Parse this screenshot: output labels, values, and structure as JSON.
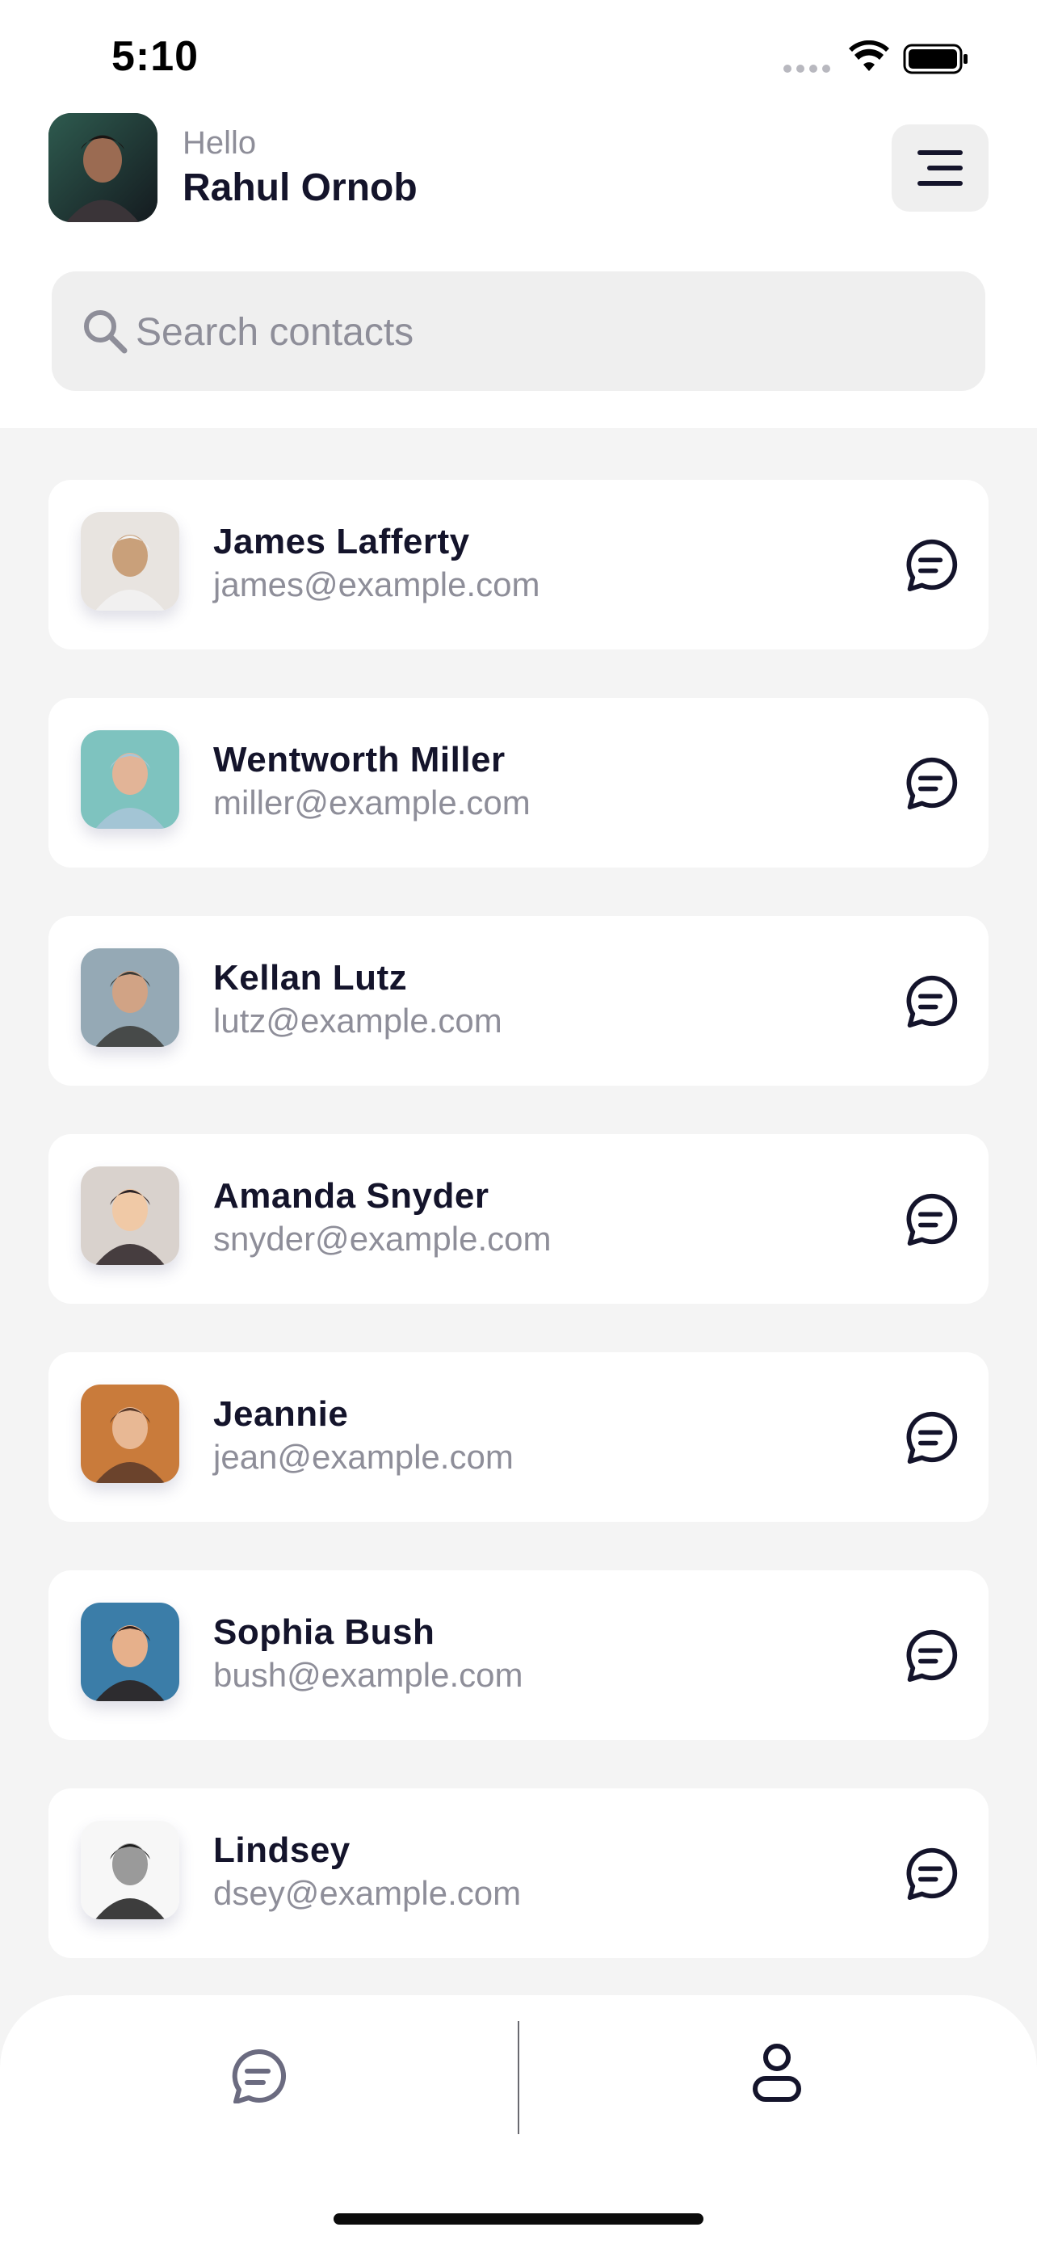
{
  "status_bar": {
    "time": "5:10",
    "icons": [
      "signal-dots-icon",
      "wifi-icon",
      "battery-icon"
    ]
  },
  "header": {
    "greeting": "Hello",
    "user_name": "Rahul Ornob",
    "menu_icon": "hamburger-menu-icon"
  },
  "search": {
    "placeholder": "Search contacts",
    "value": "",
    "icon": "search-icon"
  },
  "contacts": [
    {
      "name": "James Lafferty",
      "email": "james@example.com"
    },
    {
      "name": "Wentworth Miller",
      "email": "miller@example.com"
    },
    {
      "name": "Kellan Lutz",
      "email": "lutz@example.com"
    },
    {
      "name": "Amanda Snyder",
      "email": "snyder@example.com"
    },
    {
      "name": "Jeannie",
      "email": "jean@example.com"
    },
    {
      "name": "Sophia Bush",
      "email": "bush@example.com"
    },
    {
      "name": "Lindsey",
      "email": "dsey@example.com"
    }
  ],
  "bottom_nav": {
    "items": [
      "chat-icon",
      "user-icon"
    ],
    "active": "user-icon"
  },
  "colors": {
    "primary_text": "#14142b",
    "secondary_text": "#8e8e99",
    "list_background": "#f4f4f4",
    "search_background": "#efefef"
  }
}
